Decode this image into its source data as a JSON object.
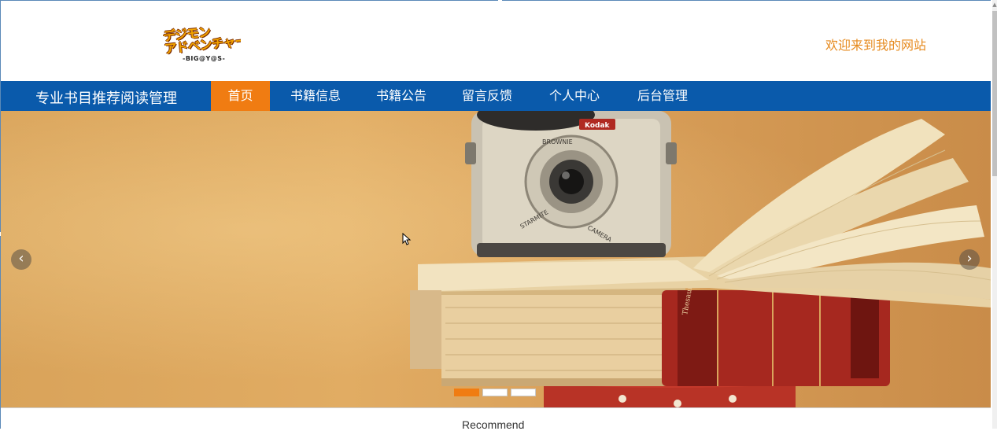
{
  "header": {
    "logo_text": "デジモン\nアドベンチャー",
    "logo_sub": "-BIG@Y@S-",
    "welcome": "欢迎来到我的网站"
  },
  "nav": {
    "site_title": "专业书目推荐阅读管理",
    "items": [
      {
        "label": "首页",
        "active": true
      },
      {
        "label": "书籍信息",
        "active": false
      },
      {
        "label": "书籍公告",
        "active": false
      },
      {
        "label": "留言反馈",
        "active": false
      },
      {
        "label": "个人中心",
        "active": false
      },
      {
        "label": "后台管理",
        "active": false
      }
    ]
  },
  "banner": {
    "prev_icon": "chevron-left-icon",
    "next_icon": "chevron-right-icon",
    "prev_glyph": "‹",
    "next_glyph": "›",
    "slides": 3,
    "active_slide": 1,
    "camera_brand": "Kodak",
    "camera_model": "BROWNIE",
    "camera_lens_text": "STARMITE CAMERA"
  },
  "section": {
    "recommend": "Recommend"
  },
  "colors": {
    "nav_bg": "#0a5aab",
    "accent": "#f07c12",
    "welcome": "#e68a1e"
  }
}
